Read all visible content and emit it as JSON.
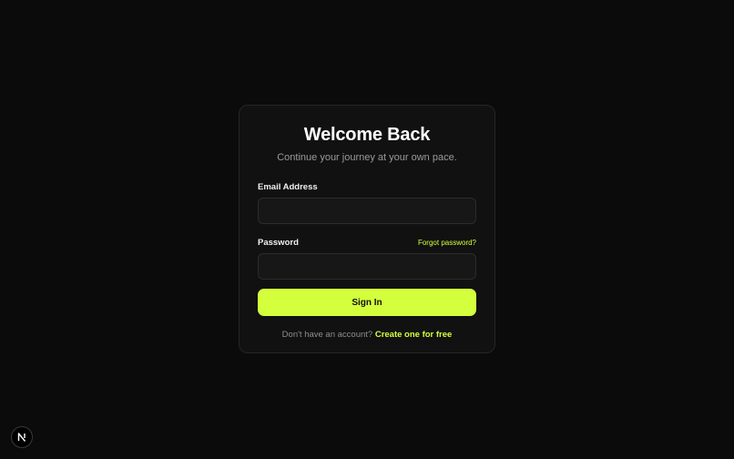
{
  "login": {
    "title": "Welcome Back",
    "subtitle": "Continue your journey at your own pace.",
    "email_label": "Email Address",
    "email_value": "",
    "password_label": "Password",
    "password_value": "",
    "forgot_label": "Forgot password?",
    "submit_label": "Sign In",
    "signup_prompt": "Don't have an account?",
    "signup_link": "Create one for free"
  },
  "badge": {
    "icon": "nextjs-logo-icon"
  },
  "colors": {
    "background": "#0b0b0b",
    "card": "#111111",
    "accent": "#d4ff3c",
    "muted_text": "#9a9a9a"
  }
}
